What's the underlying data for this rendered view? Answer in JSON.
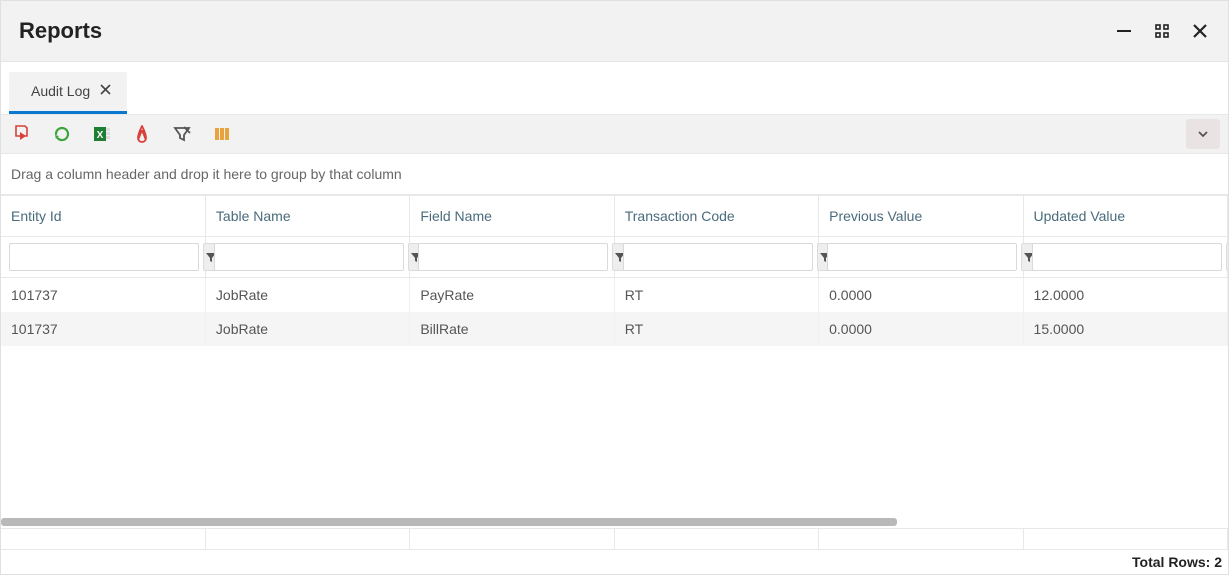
{
  "window": {
    "title": "Reports"
  },
  "tab": {
    "label": "Audit Log"
  },
  "toolbar": {
    "icons": {
      "run": "run-report-icon",
      "refresh": "refresh-icon",
      "excel": "excel-icon",
      "pdf": "pdf-icon",
      "clear_filter": "clear-filter-icon",
      "columns": "columns-icon"
    }
  },
  "grid": {
    "group_hint": "Drag a column header and drop it here to group by that column",
    "columns": [
      {
        "label": "Entity Id"
      },
      {
        "label": "Table Name"
      },
      {
        "label": "Field Name"
      },
      {
        "label": "Transaction Code"
      },
      {
        "label": "Previous Value"
      },
      {
        "label": "Updated Value"
      }
    ],
    "rows": [
      {
        "entity_id": "101737",
        "table_name": "JobRate",
        "field_name": "PayRate",
        "txn_code": "RT",
        "prev": "0.0000",
        "updated": "12.0000"
      },
      {
        "entity_id": "101737",
        "table_name": "JobRate",
        "field_name": "BillRate",
        "txn_code": "RT",
        "prev": "0.0000",
        "updated": "15.0000"
      }
    ]
  },
  "footer": {
    "total_rows_label": "Total Rows: 2"
  }
}
